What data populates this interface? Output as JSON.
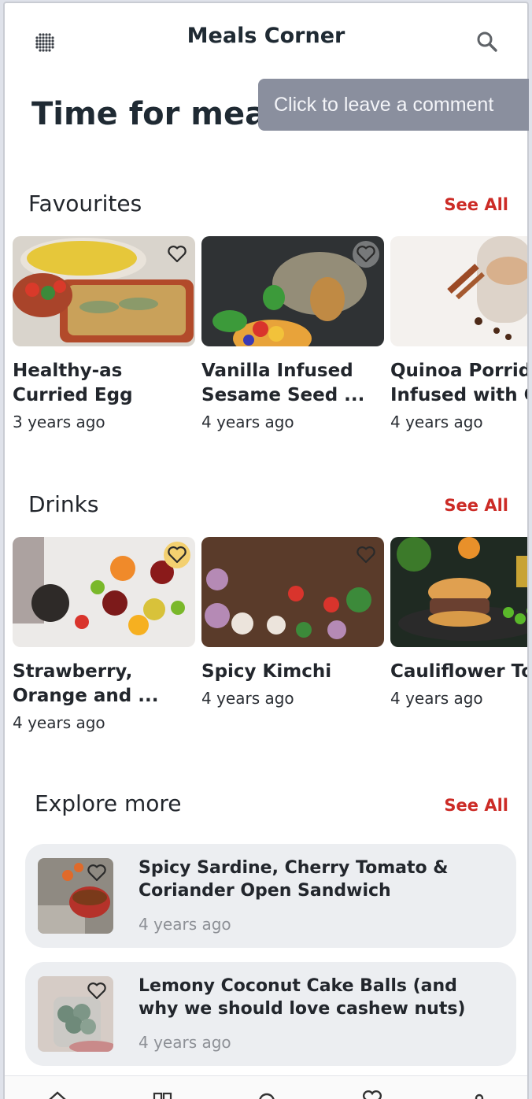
{
  "app_title": "Meals Corner",
  "headline": "Time for meals",
  "tooltip": "Click to leave a comment",
  "see_all": "See All",
  "favourites": {
    "title": "Favourites",
    "items": [
      {
        "title": "Healthy-as\nCurried Egg",
        "time": "3 years ago"
      },
      {
        "title": "Vanilla Infused\nSesame Seed ...",
        "time": "4 years ago"
      },
      {
        "title": "Quinoa Porridge\nInfused with C",
        "time": "4 years ago"
      }
    ]
  },
  "drinks": {
    "title": "Drinks",
    "items": [
      {
        "title": "Strawberry,\nOrange and ...",
        "time": "4 years ago"
      },
      {
        "title": "Spicy Kimchi",
        "time": "4 years ago"
      },
      {
        "title": "Cauliflower To",
        "time": "4 years ago"
      }
    ]
  },
  "explore": {
    "title": "Explore more",
    "items": [
      {
        "title": "Spicy Sardine, Cherry Tomato & Coriander Open Sandwich",
        "time": "4 years ago"
      },
      {
        "title": "Lemony Coconut Cake Balls (and why we should love cashew nuts)",
        "time": "4 years ago"
      }
    ]
  },
  "icons": {
    "menu": "grid-dots-icon",
    "search": "search-icon",
    "favourite": "heart-outline-icon",
    "nav": [
      "home-icon",
      "categories-icon",
      "explore-icon",
      "favourites-icon",
      "profile-icon"
    ]
  },
  "colors": {
    "accent": "#cc2b26",
    "tooltip_bg": "#8a8f9e",
    "card_bg": "#eceef1"
  }
}
